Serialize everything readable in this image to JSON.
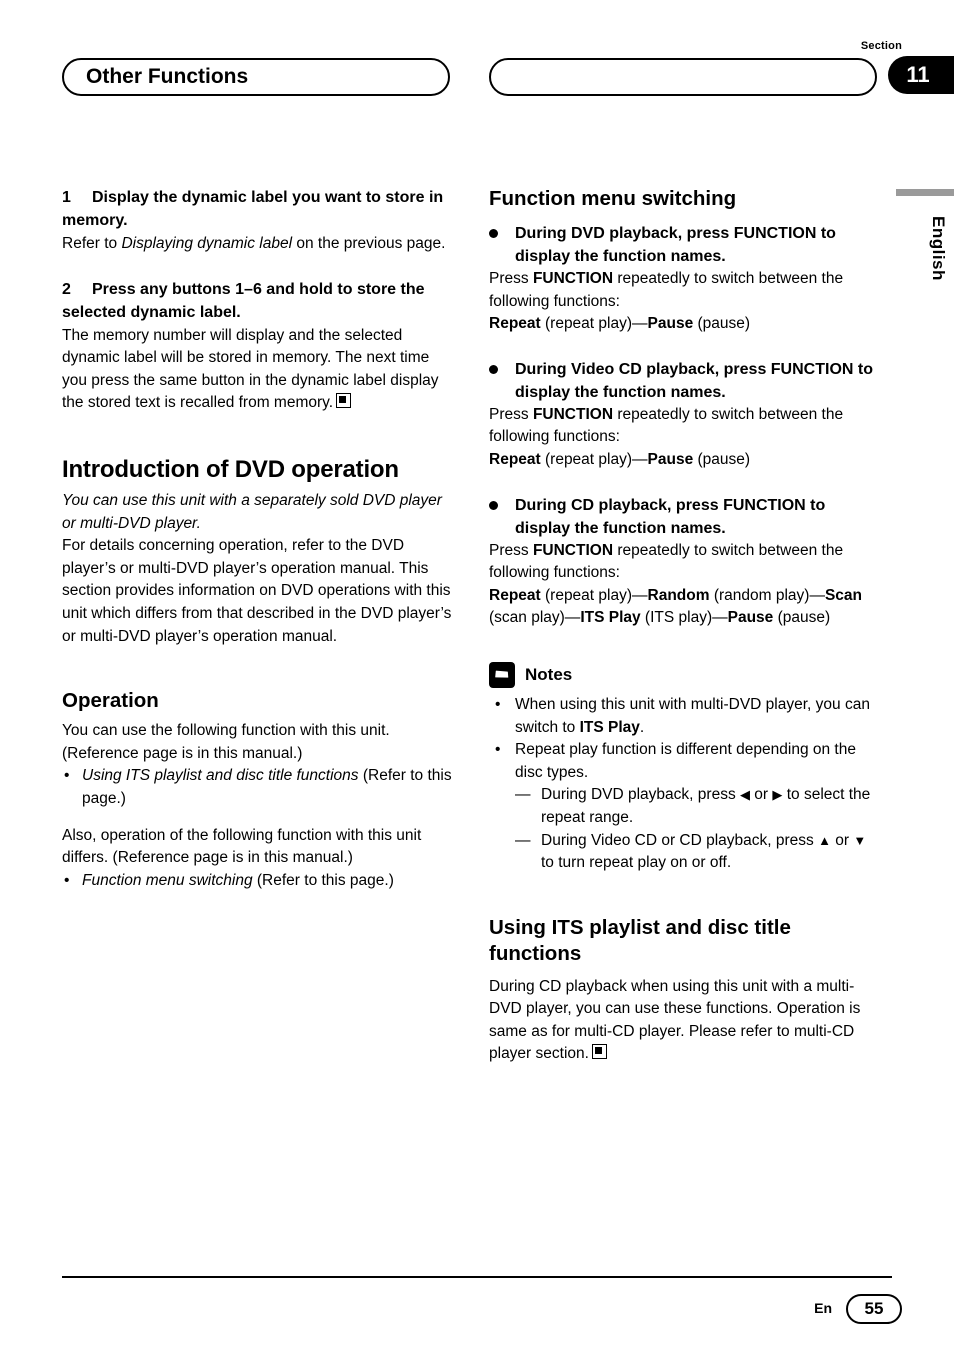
{
  "header": {
    "section_word": "Section",
    "section_number": "11",
    "title": "Other Functions"
  },
  "margin": {
    "language": "English"
  },
  "left_column": {
    "step1": {
      "number": "1",
      "title": "Display the dynamic label you want to store in memory.",
      "body_pre": "Refer to ",
      "body_italic": "Displaying dynamic label",
      "body_post": " on the previous page."
    },
    "step2": {
      "number": "2",
      "title": "Press any buttons 1–6 and hold to store the selected dynamic label.",
      "body": "The memory number will display and the selected dynamic label will be stored in memory. The next time you press the same button in the dynamic label display the stored text is recalled from memory."
    },
    "intro_heading": "Introduction of DVD operation",
    "intro_italic": "You can use this unit with a separately sold DVD player or multi-DVD player.",
    "intro_body": "For details concerning operation, refer to the DVD player’s or multi-DVD player’s operation manual. This section provides information on DVD operations with this unit which differs from that described in the DVD player’s or multi-DVD player’s operation manual.",
    "operation_heading": "Operation",
    "operation_body": "You can use the following function with this unit. (Reference page is in this manual.)",
    "operation_bullet_italic": "Using ITS playlist and disc title functions",
    "operation_bullet_rest": " (Refer to this page.)",
    "operation_body2": "Also, operation of the following function with this unit differs. (Reference page is in this manual.)",
    "operation_bullet2_italic": "Function menu switching",
    "operation_bullet2_rest": " (Refer to this page.)"
  },
  "right_column": {
    "fn_heading": "Function menu switching",
    "item1": {
      "title": "During DVD playback, press FUNCTION to display the function names.",
      "line1_pre": "Press ",
      "line1_bold": "FUNCTION",
      "line1_post": " repeatedly to switch between the following functions:",
      "line2_b1": "Repeat",
      "line2_n1": " (repeat play)—",
      "line2_b2": "Pause",
      "line2_n2": " (pause)"
    },
    "item2": {
      "title": "During Video CD playback, press FUNCTION to display the function names.",
      "line1_pre": "Press ",
      "line1_bold": "FUNCTION",
      "line1_post": " repeatedly to switch between the following functions:",
      "line2_b1": "Repeat",
      "line2_n1": " (repeat play)—",
      "line2_b2": "Pause",
      "line2_n2": " (pause)"
    },
    "item3": {
      "title": "During CD playback, press FUNCTION to display the function names.",
      "line1_pre": "Press ",
      "line1_bold": "FUNCTION",
      "line1_post": " repeatedly to switch between the following functions:",
      "seq_b1": "Repeat",
      "seq_n1": " (repeat play)—",
      "seq_b2": "Random",
      "seq_n2": " (random play)—",
      "seq_b3": "Scan",
      "seq_n3": " (scan play)—",
      "seq_b4": "ITS Play",
      "seq_n4": " (ITS play)—",
      "seq_b5": "Pause",
      "seq_n5": " (pause)"
    },
    "notes_title": "Notes",
    "note1_pre": "When using this unit with multi-DVD player, you can switch to ",
    "note1_bold": "ITS Play",
    "note1_post": ".",
    "note2": "Repeat play function is different depending on the disc types.",
    "note2_sub1_pre": "During DVD playback, press ",
    "note2_sub1_left": "◀",
    "note2_sub1_mid": " or ",
    "note2_sub1_right": "▶",
    "note2_sub1_post": " to select the repeat range.",
    "note2_sub2_pre": "During Video CD or CD playback, press ",
    "note2_sub2_up": "▲",
    "note2_sub2_mid": " or ",
    "note2_sub2_down": "▼",
    "note2_sub2_post": " to turn repeat play on or off.",
    "its_heading": "Using ITS playlist and disc title functions",
    "its_body": "During CD playback when using this unit with a multi-DVD player, you can use these functions. Operation is same as for multi-CD player. Please refer to multi-CD player section."
  },
  "footer": {
    "en": "En",
    "page": "55"
  }
}
